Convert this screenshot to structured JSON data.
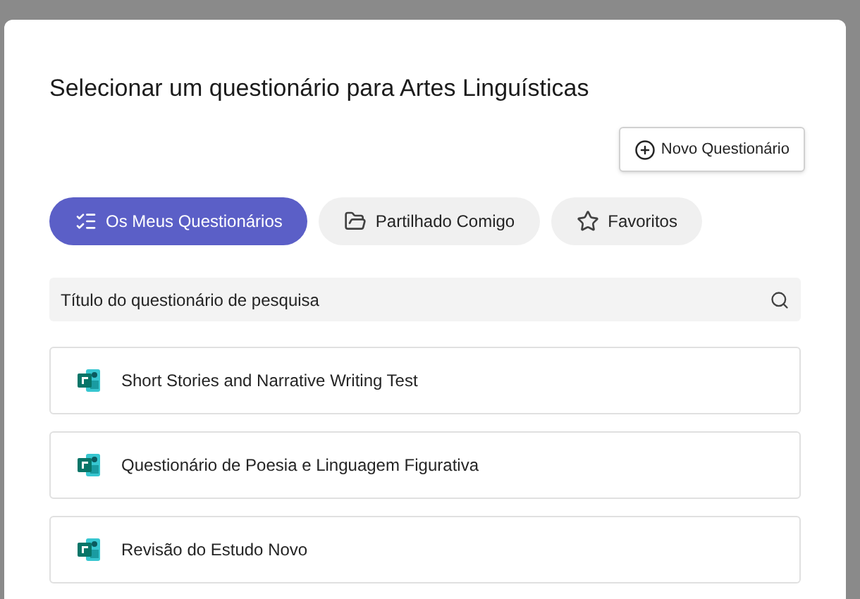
{
  "dialog": {
    "title": "Selecionar um questionário para Artes Linguísticas",
    "new_button": "Novo Questionário"
  },
  "tabs": [
    {
      "label": "Os Meus Questionários",
      "kind": "list",
      "selected": true
    },
    {
      "label": "Partilhado Comigo",
      "kind": "shared",
      "selected": false
    },
    {
      "label": "Favoritos",
      "kind": "star",
      "selected": false
    }
  ],
  "search": {
    "placeholder": "Título do questionário de pesquisa"
  },
  "quizzes": [
    {
      "title": "Short Stories and Narrative Writing Test"
    },
    {
      "title": "Questionário de Poesia e Linguagem Figurativa"
    },
    {
      "title": "Revisão do Estudo Novo"
    }
  ]
}
